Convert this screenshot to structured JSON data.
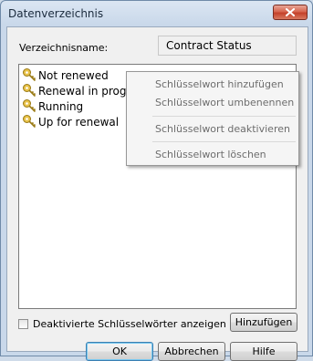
{
  "window": {
    "title": "Datenverzeichnis"
  },
  "form": {
    "name_label": "Verzeichnisname:",
    "name_value": "Contract Status"
  },
  "list": {
    "items": [
      {
        "label": "Not renewed"
      },
      {
        "label": "Renewal in progress"
      },
      {
        "label": "Running"
      },
      {
        "label": "Up for renewal"
      }
    ]
  },
  "context_menu": {
    "items": [
      {
        "label": "Schlüsselwort hinzufügen"
      },
      {
        "label": "Schlüsselwort umbenennen"
      },
      {
        "label": "Schlüsselwort deaktivieren"
      },
      {
        "label": "Schlüsselwort löschen"
      }
    ]
  },
  "options": {
    "show_disabled_label": "Deaktivierte Schlüsselwörter anzeigen",
    "show_disabled_checked": false
  },
  "buttons": {
    "add": "Hinzufügen",
    "ok": "OK",
    "cancel": "Abbrechen",
    "help": "Hilfe"
  },
  "icons": {
    "close": "close-icon",
    "keyword": "key-icon"
  },
  "colors": {
    "key_fill": "#e8c24a",
    "close_red": "#c4412a"
  }
}
